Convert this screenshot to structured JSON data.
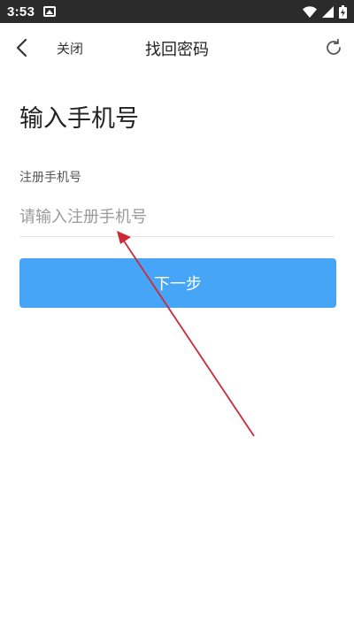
{
  "status_bar": {
    "time": "3:53",
    "icons": [
      "photo-icon",
      "wifi-icon",
      "cellular-signal-icon",
      "battery-charging-icon"
    ]
  },
  "nav": {
    "back_icon": "chevron-left-icon",
    "close_label": "关闭",
    "title": "找回密码",
    "refresh_icon": "refresh-icon"
  },
  "form": {
    "heading": "输入手机号",
    "phone_label": "注册手机号",
    "phone_placeholder": "请输入注册手机号",
    "phone_value": "",
    "next_button_label": "下一步"
  },
  "colors": {
    "status_bar_bg": "#2b2b2b",
    "primary_button": "#47a5f8",
    "annotation_arrow": "#cc2a36"
  }
}
